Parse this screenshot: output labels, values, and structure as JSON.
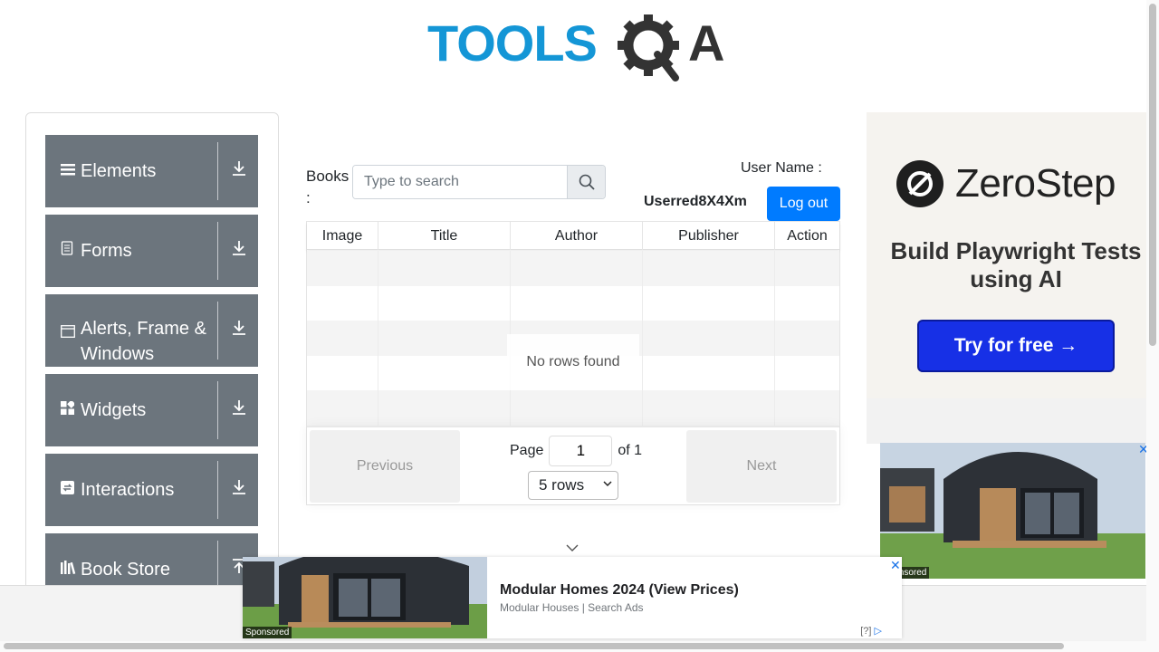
{
  "logo": {
    "part1": "TOOLS",
    "part2": "A"
  },
  "sidebar": {
    "items": [
      {
        "label": "Elements",
        "icon": "hamburger-icon"
      },
      {
        "label": "Forms",
        "icon": "document-icon"
      },
      {
        "label": "Alerts, Frame & Windows",
        "icon": "window-icon"
      },
      {
        "label": "Widgets",
        "icon": "widgets-icon"
      },
      {
        "label": "Interactions",
        "icon": "interactions-icon"
      },
      {
        "label": "Book Store",
        "icon": "books-icon"
      }
    ]
  },
  "main": {
    "books_label": "Books :",
    "search": {
      "placeholder": "Type to search"
    },
    "user_label": "User Name :",
    "user_value": "Userred8X4Xm",
    "logout_label": "Log out",
    "table": {
      "columns": [
        "Image",
        "Title",
        "Author",
        "Publisher",
        "Action"
      ],
      "empty_text": "No rows found"
    },
    "pagination": {
      "previous_label": "Previous",
      "next_label": "Next",
      "page_label": "Page",
      "page_value": "1",
      "of_label": "of 1",
      "rows_value": "5 rows"
    }
  },
  "ad_right": {
    "brand": "ZeroStep",
    "headline": "Build Playwright Tests using AI",
    "cta": "Try for free →",
    "sponsored": "Sponsored"
  },
  "ad_bottom": {
    "title": "Modular Homes 2024 (View Prices)",
    "subtitle": "Modular Houses | Search Ads",
    "sponsored": "Sponsored",
    "q": "[?]"
  },
  "colors": {
    "brand_blue": "#1496d6",
    "brand_dark": "#333333",
    "sidebar_bg": "#6c757d",
    "primary": "#007bff",
    "cta_blue": "#1730e6"
  }
}
